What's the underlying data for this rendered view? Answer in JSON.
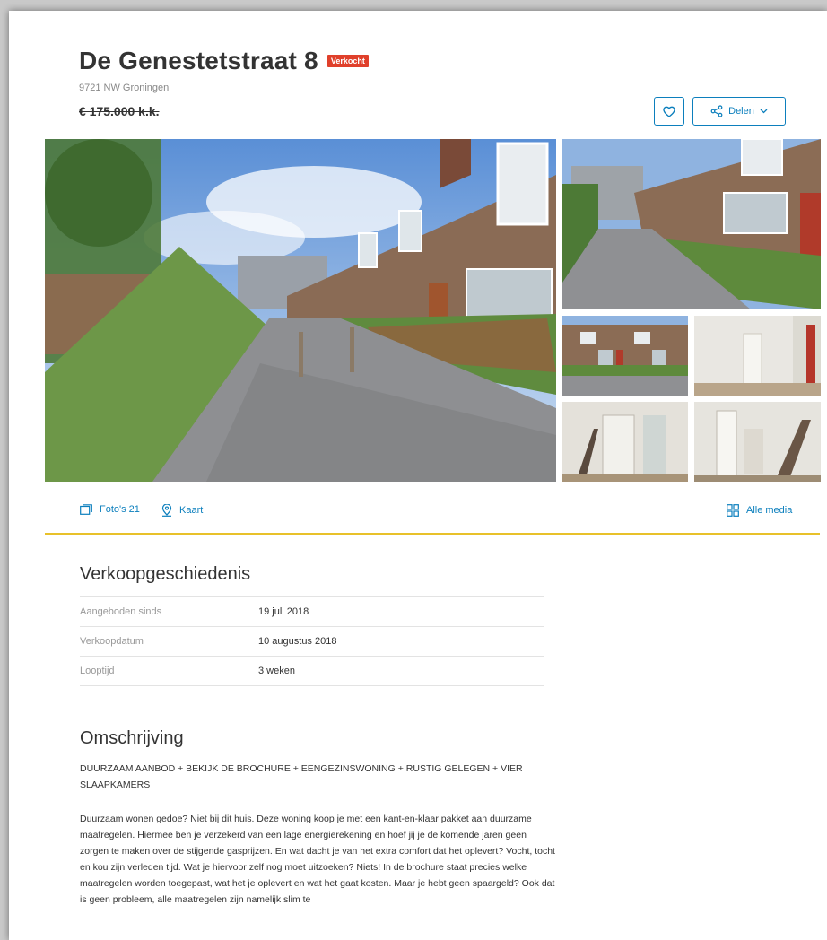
{
  "listing": {
    "title": "De Genestetstraat 8",
    "status_badge": "Verkocht",
    "address": "9721 NW Groningen",
    "price": "€ 175.000 k.k."
  },
  "actions": {
    "share_label": "Delen",
    "favorite_icon": "heart-icon",
    "share_icon": "share-icon",
    "accent_color": "#0c7fbd",
    "badge_color": "#e0402b"
  },
  "media": {
    "photos_label": "Foto's 21",
    "map_label": "Kaart",
    "all_media_label": "Alle media"
  },
  "history": {
    "title": "Verkoopgeschiedenis",
    "rows": [
      {
        "label": "Aangeboden sinds",
        "value": "19 juli 2018"
      },
      {
        "label": "Verkoopdatum",
        "value": "10 augustus 2018"
      },
      {
        "label": "Looptijd",
        "value": "3 weken"
      }
    ]
  },
  "description": {
    "title": "Omschrijving",
    "headline": "DUURZAAM AANBOD + BEKIJK DE BROCHURE + EENGEZINSWONING + RUSTIG GELEGEN + VIER SLAAPKAMERS",
    "body": "Duurzaam wonen gedoe? Niet bij dit huis. Deze woning koop je met een kant-en-klaar pakket aan duurzame maatregelen. Hiermee ben je verzekerd van een lage energierekening en hoef jij je de komende jaren geen zorgen te maken over de stijgende gasprijzen. En wat dacht je van het extra comfort dat het oplevert? Vocht, tocht en kou zijn verleden tijd. Wat je hiervoor zelf nog moet uitzoeken? Niets! In de brochure staat precies welke maatregelen worden toegepast, wat het je oplevert en wat het gaat kosten. Maar je hebt geen spaargeld? Ook dat is geen probleem, alle maatregelen zijn namelijk slim te"
  }
}
